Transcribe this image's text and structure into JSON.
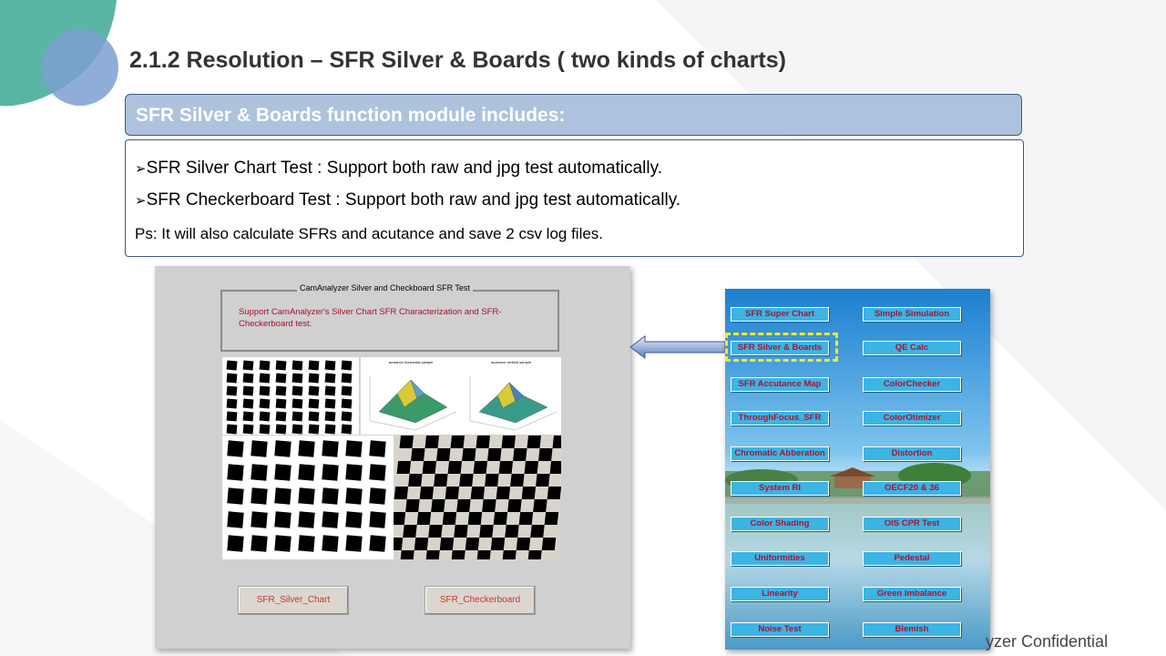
{
  "slide": {
    "title": "2.1.2  Resolution –  SFR Silver & Boards ( two kinds of charts)",
    "header": "SFR Silver & Boards  function module includes:",
    "bullet_symbol": "➢",
    "bullets": [
      "SFR Silver Chart Test : Support both raw and jpg test automatically.",
      "SFR Checkerboard Test : Support both raw and jpg test automatically."
    ],
    "ps": "Ps: It will also calculate SFRs and acutance and save 2 csv log files.",
    "footer": "yzer  Confidential"
  },
  "app": {
    "group_title": "CamAnalyzer Silver and Checkboard SFR Test",
    "description": "Support CamAnalyzer's Silver Chart SFR Characterization and SFR-Checkerboard test.",
    "plot_left_title": "acutance horizontal sample",
    "plot_right_title": "acutance vertical sample",
    "buttons": [
      "SFR_Silver_Chart",
      "SFR_Checkerboard"
    ]
  },
  "menu": {
    "left": [
      "SFR Super Chart",
      "SFR Silver & Boards",
      "SFR Accutance Map",
      "ThroughFocus_SFR",
      "Chromatic Abberation",
      "System RI",
      "Color Shading",
      "Uniformities",
      "Linearity",
      "Noise Test"
    ],
    "right": [
      "Simple Simulation",
      "QE Calc",
      "ColorChecker",
      "ColorOtimizer",
      "Distortion",
      "OECF20 & 36",
      "OIS CPR Test",
      "Pedestal",
      "Green Imbalance",
      "Blemish"
    ],
    "selected": "SFR Silver & Boards"
  },
  "colors": {
    "header_bg": "#adc2dc",
    "accent_teal": "#5bb5a5",
    "accent_blue": "#7c9fd0",
    "menu_button": "#3cb4e4",
    "menu_text": "#b0102e",
    "highlight": "#f2ec1a"
  }
}
